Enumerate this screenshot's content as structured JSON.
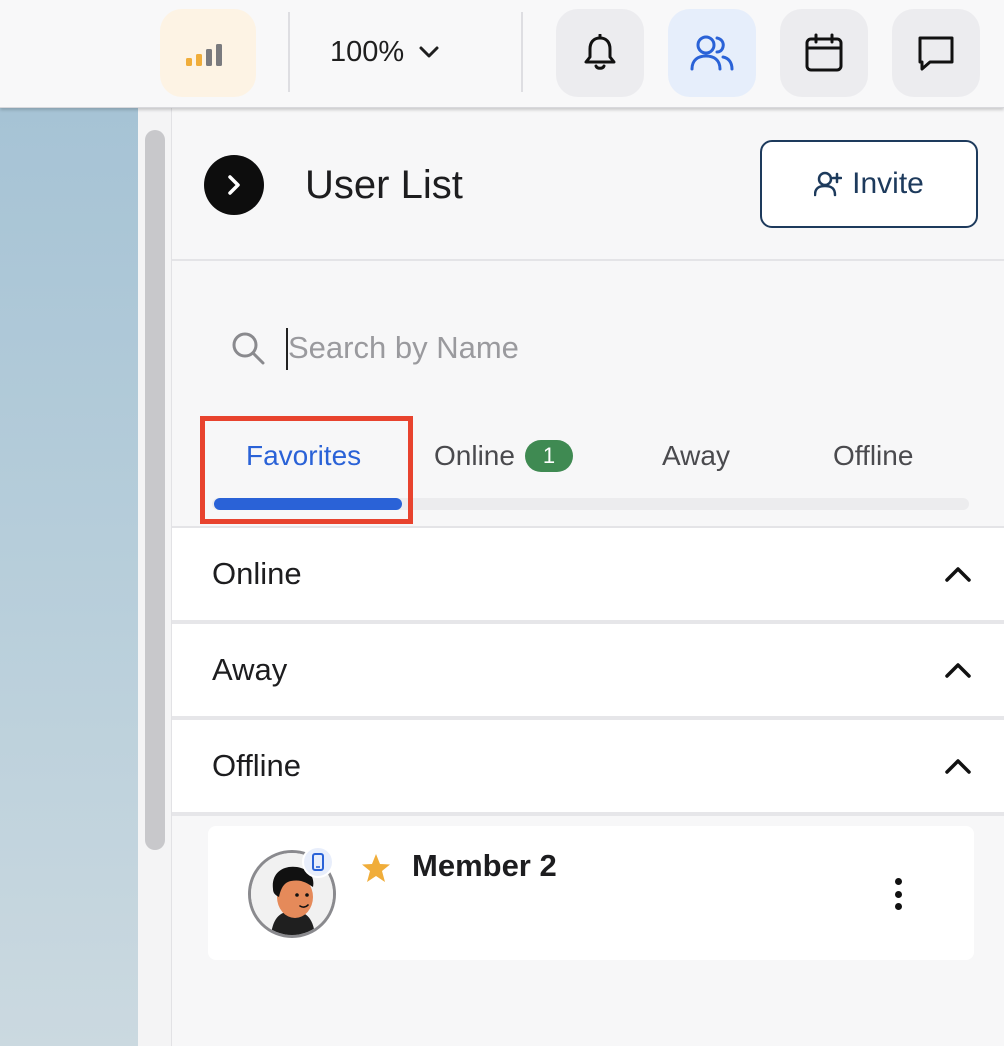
{
  "topbar": {
    "zoom_label": "100%"
  },
  "header": {
    "title": "User List",
    "invite_label": "Invite"
  },
  "search": {
    "placeholder": "Search by Name",
    "value": ""
  },
  "tabs": [
    {
      "label": "Favorites",
      "active": true
    },
    {
      "label": "Online",
      "badge": "1"
    },
    {
      "label": "Away"
    },
    {
      "label": "Offline"
    }
  ],
  "sections": [
    {
      "label": "Online"
    },
    {
      "label": "Away"
    },
    {
      "label": "Offline"
    }
  ],
  "members": [
    {
      "name": "Member 2",
      "favorite": true,
      "device": "mobile-icon"
    }
  ],
  "colors": {
    "accent": "#2a62d7",
    "badge_green": "#3f8a52",
    "highlight": "#e8432e",
    "invite_border": "#1d3a5c",
    "star": "#f0ad3a"
  },
  "icons": {
    "signal": "signal-bars-icon",
    "zoom": "chevron-down-icon",
    "bell": "bell-icon",
    "users": "users-icon",
    "calendar": "calendar-icon",
    "chat": "chat-icon",
    "collapse": "chevron-right-icon",
    "invite": "user-plus-icon",
    "search": "search-icon",
    "section": "chevron-up-icon",
    "more": "more-vertical-icon"
  }
}
